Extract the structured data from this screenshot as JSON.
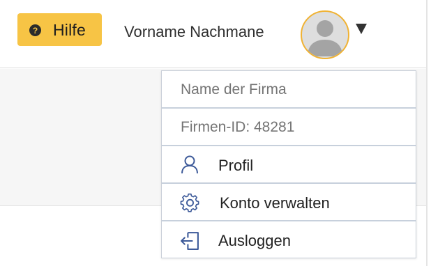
{
  "header": {
    "help_label": "Hilfe",
    "help_icon": "question-mark",
    "user_name": "Vorname Nachmane",
    "avatar": "default-user-avatar",
    "dropdown_indicator": "▼"
  },
  "dropdown": {
    "company_name": "Name der Firma",
    "company_id": "Firmen-ID: 48281",
    "items": [
      {
        "label": "Profil",
        "icon": "user-icon"
      },
      {
        "label": "Konto verwalten",
        "icon": "gear-icon"
      },
      {
        "label": "Ausloggen",
        "icon": "logout-icon"
      }
    ]
  },
  "colors": {
    "help_button": "#f7c445",
    "avatar_ring": "#f0b233",
    "menu_icon": "#3d5a99",
    "divider": "#c7d0dc"
  }
}
